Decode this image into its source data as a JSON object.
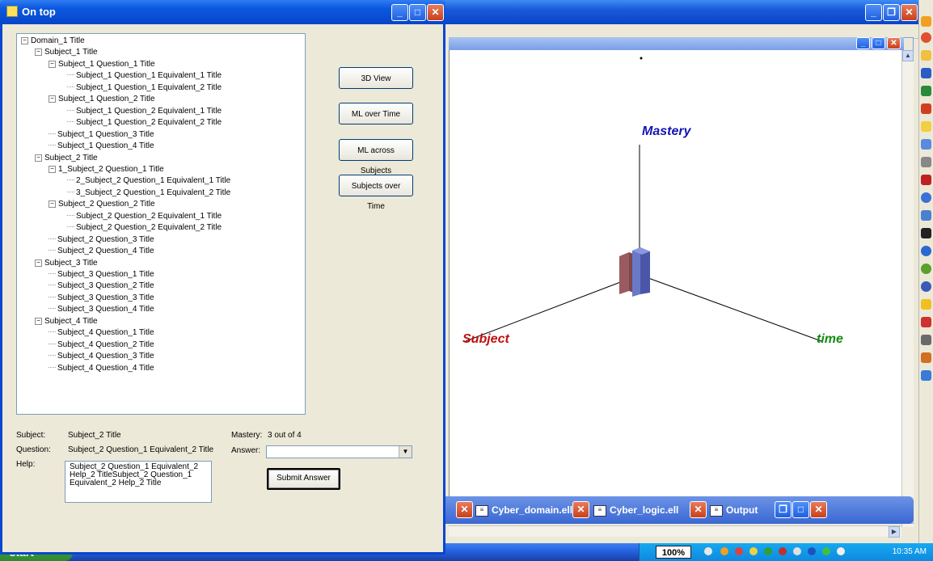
{
  "dialog": {
    "title": "On top",
    "tree": [
      {
        "label": "Domain_1 Title",
        "level": 0,
        "expander": "−"
      },
      {
        "label": "Subject_1 Title",
        "level": 1,
        "expander": "−"
      },
      {
        "label": "Subject_1 Question_1 Title",
        "level": 2,
        "expander": "−"
      },
      {
        "label": "Subject_1 Question_1 Equivalent_1 Title",
        "level": 3,
        "expander": ""
      },
      {
        "label": "Subject_1 Question_1 Equivalent_2 Title",
        "level": 3,
        "expander": ""
      },
      {
        "label": "Subject_1 Question_2 Title",
        "level": 2,
        "expander": "−"
      },
      {
        "label": "Subject_1 Question_2 Equivalent_1 Title",
        "level": 3,
        "expander": ""
      },
      {
        "label": "Subject_1 Question_2 Equivalent_2 Title",
        "level": 3,
        "expander": ""
      },
      {
        "label": "Subject_1 Question_3 Title",
        "level": 2,
        "expander": ""
      },
      {
        "label": "Subject_1 Question_4 Title",
        "level": 2,
        "expander": ""
      },
      {
        "label": "Subject_2 Title",
        "level": 1,
        "expander": "−"
      },
      {
        "label": "1_Subject_2 Question_1 Title",
        "level": 2,
        "expander": "−"
      },
      {
        "label": "2_Subject_2 Question_1 Equivalent_1 Title",
        "level": 3,
        "expander": ""
      },
      {
        "label": "3_Subject_2 Question_1 Equivalent_2 Title",
        "level": 3,
        "expander": ""
      },
      {
        "label": "Subject_2 Question_2 Title",
        "level": 2,
        "expander": "−"
      },
      {
        "label": "Subject_2 Question_2 Equivalent_1 Title",
        "level": 3,
        "expander": ""
      },
      {
        "label": "Subject_2 Question_2 Equivalent_2 Title",
        "level": 3,
        "expander": ""
      },
      {
        "label": "Subject_2 Question_3 Title",
        "level": 2,
        "expander": ""
      },
      {
        "label": "Subject_2 Question_4 Title",
        "level": 2,
        "expander": ""
      },
      {
        "label": "Subject_3 Title",
        "level": 1,
        "expander": "−"
      },
      {
        "label": "Subject_3 Question_1 Title",
        "level": 2,
        "expander": ""
      },
      {
        "label": "Subject_3 Question_2 Title",
        "level": 2,
        "expander": ""
      },
      {
        "label": "Subject_3 Question_3 Title",
        "level": 2,
        "expander": ""
      },
      {
        "label": "Subject_3 Question_4 Title",
        "level": 2,
        "expander": ""
      },
      {
        "label": "Subject_4 Title",
        "level": 1,
        "expander": "−"
      },
      {
        "label": "Subject_4 Question_1 Title",
        "level": 2,
        "expander": ""
      },
      {
        "label": "Subject_4 Question_2 Title",
        "level": 2,
        "expander": ""
      },
      {
        "label": "Subject_4 Question_3 Title",
        "level": 2,
        "expander": ""
      },
      {
        "label": "Subject_4 Question_4 Title",
        "level": 2,
        "expander": ""
      }
    ],
    "buttons": {
      "view3d": "3D View",
      "ml_over_time": "ML over Time",
      "ml_across_subjects": "ML across Subjects",
      "subjects_over_time": "Subjects over Time",
      "submit": "Submit Answer"
    },
    "fields": {
      "subject_label": "Subject:",
      "subject_value": "Subject_2 Title",
      "question_label": "Question:",
      "question_value": "Subject_2 Question_1 Equivalent_2 Title",
      "help_label": "Help:",
      "help_value": "Subject_2 Question_1 Equivalent_2 Help_2 TitleSubject_2 Question_1 Equivalent_2 Help_2 Title",
      "mastery_label": "Mastery:",
      "mastery_value": "3 out of 4",
      "answer_label": "Answer:",
      "answer_value": ""
    }
  },
  "viewer": {
    "axes": {
      "mastery": "Mastery",
      "subject": "Subject",
      "time": "time"
    },
    "colors": {
      "mastery": "#1414b4",
      "subject": "#c01010",
      "time": "#148c14",
      "bar_front": "#6a78c8",
      "bar_back": "#9a5a60"
    }
  },
  "doc_tabs": [
    {
      "label": "Cyber_domain.ell"
    },
    {
      "label": "Cyber_logic.ell"
    },
    {
      "label": "Output"
    }
  ],
  "taskbar": {
    "start": "start",
    "zoom": "100%",
    "clock": "10:35 AM"
  }
}
